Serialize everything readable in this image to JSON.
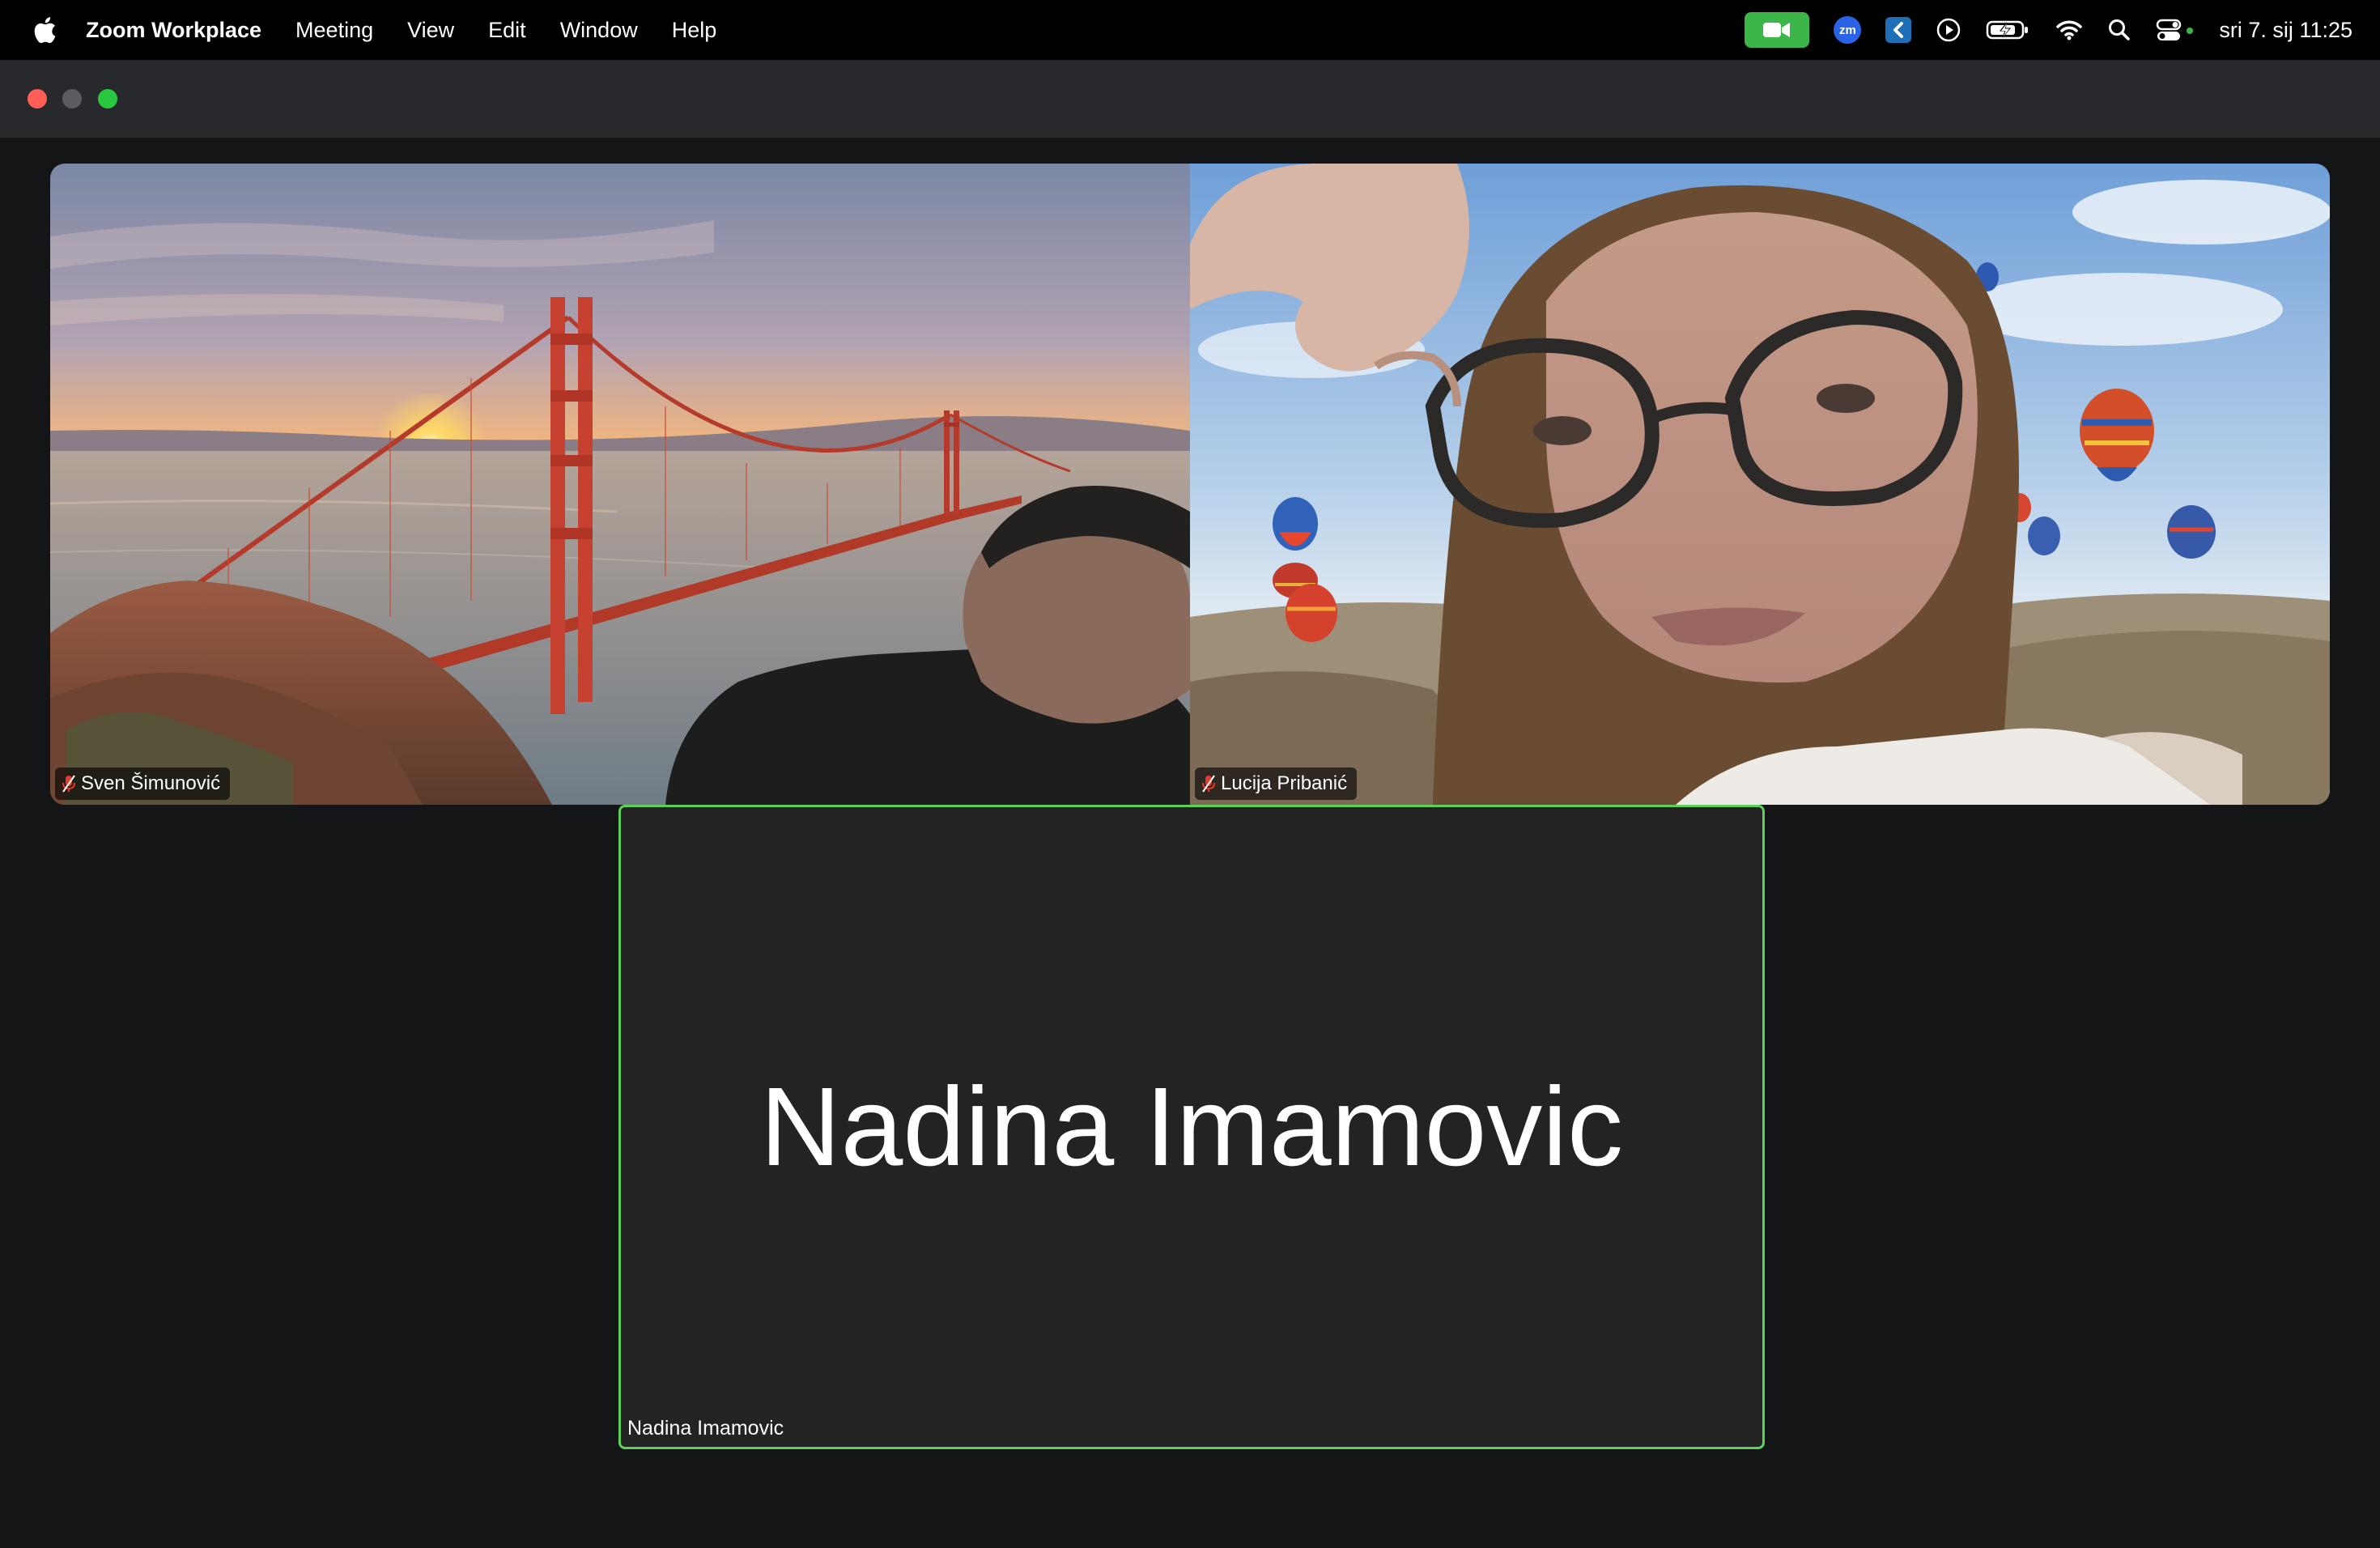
{
  "menubar": {
    "app_name": "Zoom Workplace",
    "items": [
      "Meeting",
      "View",
      "Edit",
      "Window",
      "Help"
    ],
    "status_icons": [
      "zoom-camera-icon",
      "zoom-badge-icon",
      "k-app-icon",
      "play-icon",
      "battery-charging-icon",
      "wifi-icon",
      "search-icon",
      "control-center-icon"
    ],
    "zm_badge": "zm",
    "clock": "sri 7. sij  11:25"
  },
  "window": {
    "traffic_lights": [
      "close",
      "minimize",
      "maximize"
    ]
  },
  "participants": [
    {
      "name": "Sven Šimunović",
      "muted": true,
      "video": "on",
      "background": "golden-gate-bridge-sunset"
    },
    {
      "name": "Lucija Pribanić",
      "muted": true,
      "video": "on",
      "background": "hot-air-balloons"
    },
    {
      "name": "Nadina Imamovic",
      "muted": false,
      "video": "off",
      "active_speaker": true
    }
  ],
  "colors": {
    "active_speaker_border": "#5ed05a",
    "zoom_green": "#3cb549",
    "muted_red": "#e8372c",
    "stage_bg": "#141517"
  }
}
